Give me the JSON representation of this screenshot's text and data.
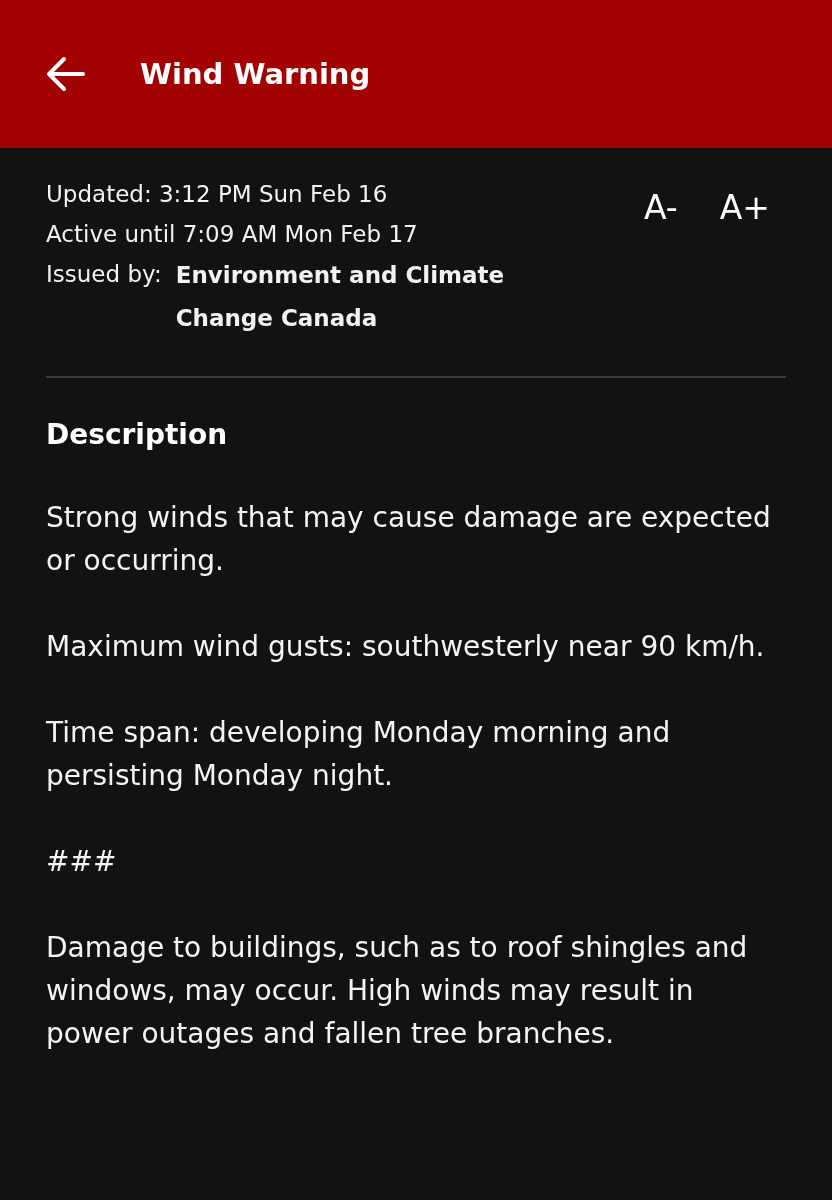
{
  "header": {
    "title": "Wind Warning"
  },
  "meta": {
    "updated": "Updated: 3:12 PM Sun Feb 16",
    "active_until": "Active until 7:09 AM Mon Feb 17",
    "issued_by_label": "Issued by:",
    "issued_by": "Environment and Climate Change Canada"
  },
  "font_size_buttons": [
    "A-",
    "A+"
  ],
  "description": {
    "heading": "Description",
    "paragraphs": [
      "Strong winds that may cause damage are expected or occurring.",
      "Maximum wind gusts: southwesterly near 90 km/h.",
      "Time span: developing Monday morning and persisting Monday night.",
      "###",
      "Damage to buildings, such as to roof shingles and windows, may occur. High winds may result in power outages and fallen tree branches."
    ]
  }
}
